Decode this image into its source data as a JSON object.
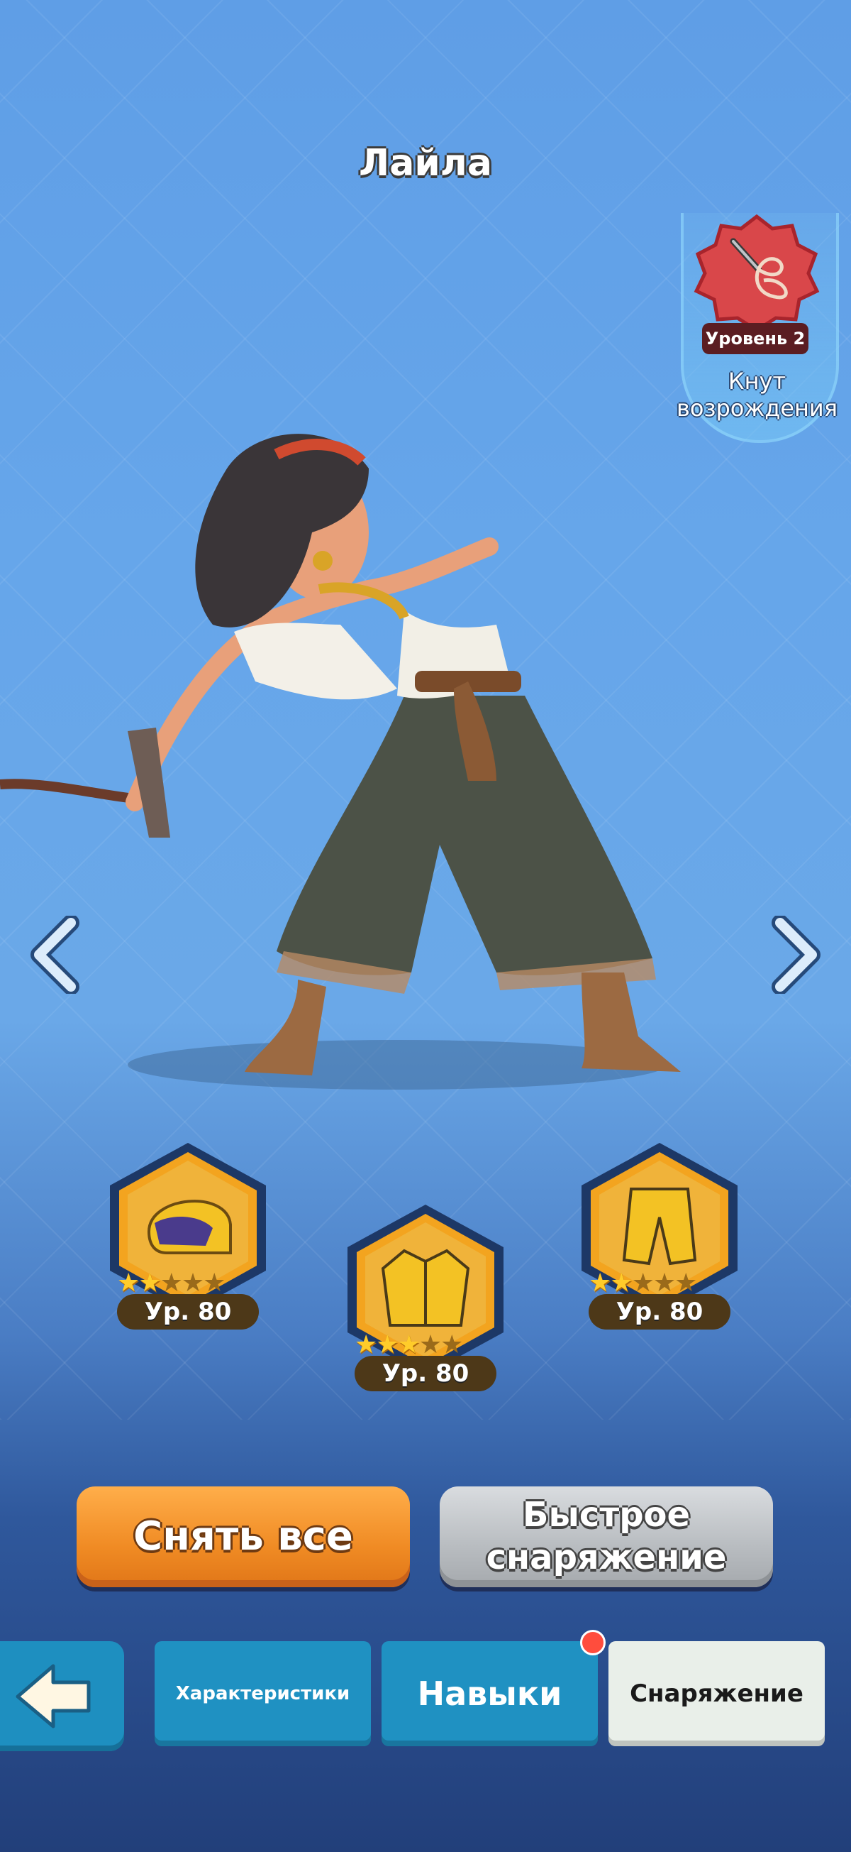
{
  "hero": {
    "name": "Лайла"
  },
  "weapon": {
    "level_label": "Уровень 2",
    "name": "Кнут возрождения",
    "icon": "whip-icon"
  },
  "equipment": [
    {
      "slot": "helmet",
      "icon": "helmet-icon",
      "stars": 2,
      "max_stars": 5,
      "level_label": "Ур. 80"
    },
    {
      "slot": "jacket",
      "icon": "jacket-icon",
      "stars": 3,
      "max_stars": 5,
      "level_label": "Ур. 80"
    },
    {
      "slot": "pants",
      "icon": "pants-icon",
      "stars": 2,
      "max_stars": 5,
      "level_label": "Ур. 80"
    }
  ],
  "actions": {
    "unequip_all": "Снять все",
    "quick_equip_line1": "Быстрое",
    "quick_equip_line2": "снаряжение"
  },
  "tabs": [
    {
      "label": "Характеристики",
      "active": false
    },
    {
      "label": "Навыки",
      "active": false,
      "notification": true
    },
    {
      "label": "Снаряжение",
      "active": true
    }
  ],
  "colors": {
    "accent_orange": "#f08b24",
    "tab_blue": "#1f91c2",
    "weapon_red": "#d9474a",
    "notification": "#ff4d3d"
  }
}
